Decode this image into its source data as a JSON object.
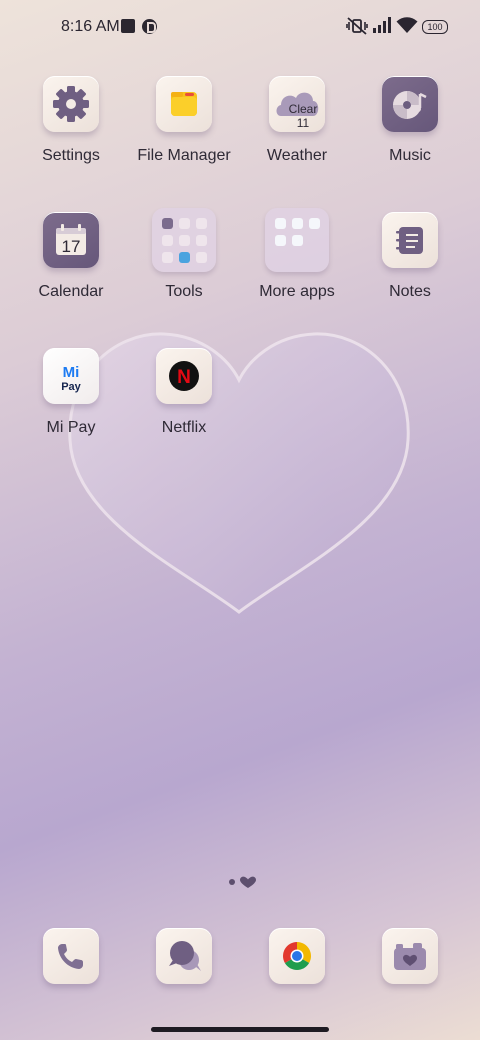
{
  "status_bar": {
    "time": "8:16 AM",
    "battery": "100"
  },
  "apps": [
    {
      "label": "Settings",
      "icon": "gear-icon"
    },
    {
      "label": "File Manager",
      "icon": "folder-icon"
    },
    {
      "label": "Weather",
      "icon": "cloud-icon",
      "badge": "Clear 11"
    },
    {
      "label": "Music",
      "icon": "music-disc-icon"
    },
    {
      "label": "Calendar",
      "icon": "calendar-icon",
      "date": "17"
    },
    {
      "label": "Tools",
      "icon": "folder-tools-icon"
    },
    {
      "label": "More apps",
      "icon": "folder-more-apps-icon"
    },
    {
      "label": "Notes",
      "icon": "notes-icon"
    },
    {
      "label": "Mi Pay",
      "icon": "mi-pay-icon",
      "logo_text_top": "Mi",
      "logo_text_bottom": "Pay"
    },
    {
      "label": "Netflix",
      "icon": "netflix-icon",
      "logo_text": "N"
    }
  ],
  "dock": [
    {
      "icon": "phone-icon"
    },
    {
      "icon": "messages-icon"
    },
    {
      "icon": "chrome-icon"
    },
    {
      "icon": "camera-icon"
    }
  ],
  "colors": {
    "accent": "#6f5f82",
    "tile_light": "#f5ede7",
    "text": "#2f2a36"
  }
}
